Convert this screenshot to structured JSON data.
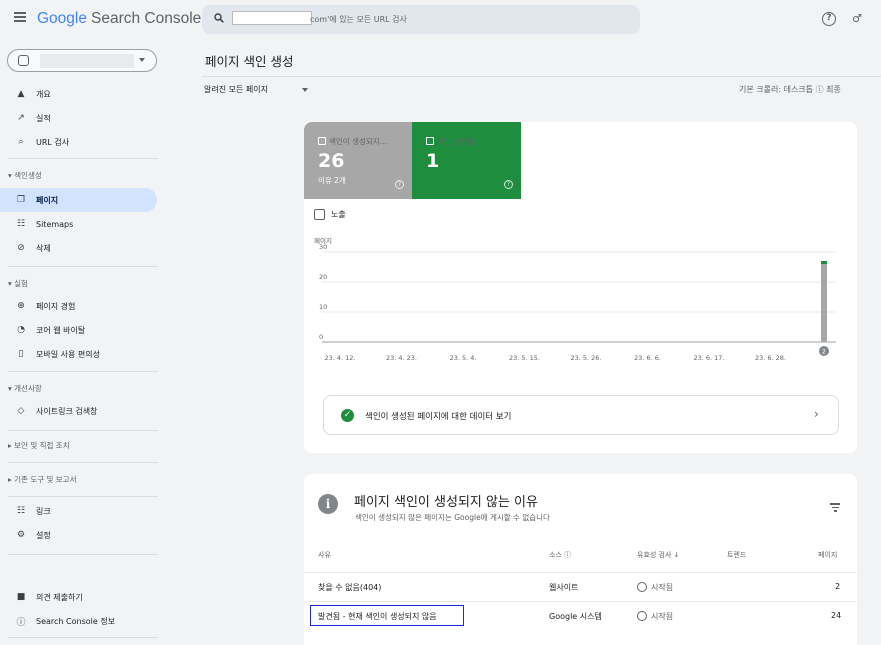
{
  "app": {
    "logo_google": "Google",
    "logo_product": "Search Console",
    "search_placeholder": "com'에 있는 모든 URL 검사"
  },
  "sidebar": {
    "items": [
      {
        "label": "개요",
        "icon": "home-icon"
      },
      {
        "label": "실적",
        "icon": "trend-icon"
      },
      {
        "label": "URL 검사",
        "icon": "search-icon"
      }
    ],
    "index_section": "색인생성",
    "index_items": [
      {
        "label": "페이지",
        "icon": "pages-icon",
        "active": true
      },
      {
        "label": "Sitemaps",
        "icon": "sitemap-icon"
      },
      {
        "label": "삭제",
        "icon": "remove-icon"
      }
    ],
    "experience_section": "실험",
    "experience_items": [
      {
        "label": "페이지 경험",
        "icon": "plus-circle-icon"
      },
      {
        "label": "코어 웹 바이탈",
        "icon": "gauge-icon"
      },
      {
        "label": "모바일 사용 편의성",
        "icon": "phone-icon"
      }
    ],
    "enhance_section": "개선사항",
    "enhance_items": [
      {
        "label": "사이트링크 검색창",
        "icon": "diamond-icon"
      }
    ],
    "security_section": "보안 및 직접 조치",
    "legacy_section": "기존 도구 및 보고서",
    "misc_items": [
      {
        "label": "링크",
        "icon": "links-icon"
      },
      {
        "label": "설정",
        "icon": "gear-icon"
      }
    ],
    "footer_items": [
      {
        "label": "의견 제출하기",
        "icon": "feedback-icon"
      },
      {
        "label": "Search Console 정보",
        "icon": "info-icon"
      }
    ]
  },
  "main": {
    "title": "페이지 색인 생성",
    "filter_label": "알려진 모든 페이지",
    "crawler": "기본 크롤러: 데스크톱 ⓘ  최종"
  },
  "tiles": {
    "not_indexed": {
      "label": "색인이 생성되지...",
      "value": "26",
      "sub": "이유 2개",
      "color": "#a7a7a7"
    },
    "indexed": {
      "label": "색인 생성됨",
      "value": "1",
      "color": "#1e8e3e"
    }
  },
  "impressions_label": "노출",
  "chart_data": {
    "type": "bar",
    "ylabel": "페이지",
    "ylim": [
      0,
      30
    ],
    "yticks": [
      0,
      10,
      20,
      30
    ],
    "x_ticks": [
      "23. 4. 12.",
      "23. 4. 23.",
      "23. 5. 4.",
      "23. 5. 15.",
      "23. 5. 26.",
      "23. 6. 6.",
      "23. 6. 17.",
      "23. 6. 28."
    ],
    "series": [
      {
        "name": "색인이 생성되지 않음",
        "color": "#a7a7a7",
        "values": [
          26
        ]
      },
      {
        "name": "색인 생성됨",
        "color": "#1e8e3e",
        "values": [
          1
        ]
      }
    ],
    "annotation": "2"
  },
  "view_indexed_link": "색인이 생성된 페이지에 대한 데이터 보기",
  "reasons": {
    "title": "페이지 색인이 생성되지 않는 이유",
    "subtitle": "색인이 생성되지 않은 페이지는 Google에 게시할 수 없습니다",
    "headers": {
      "reason": "사유",
      "source": "소스 ⓘ",
      "validation": "유효성 검사 ↓",
      "trend": "트렌드",
      "pages": "페이지"
    },
    "rows": [
      {
        "reason": "찾을 수 없음(404)",
        "source": "웹사이트",
        "validation": "시작됨",
        "pages": "2"
      },
      {
        "reason": "발견됨 - 현재 색인이 생성되지 않음",
        "source": "Google 시스템",
        "validation": "시작됨",
        "pages": "24"
      }
    ]
  }
}
